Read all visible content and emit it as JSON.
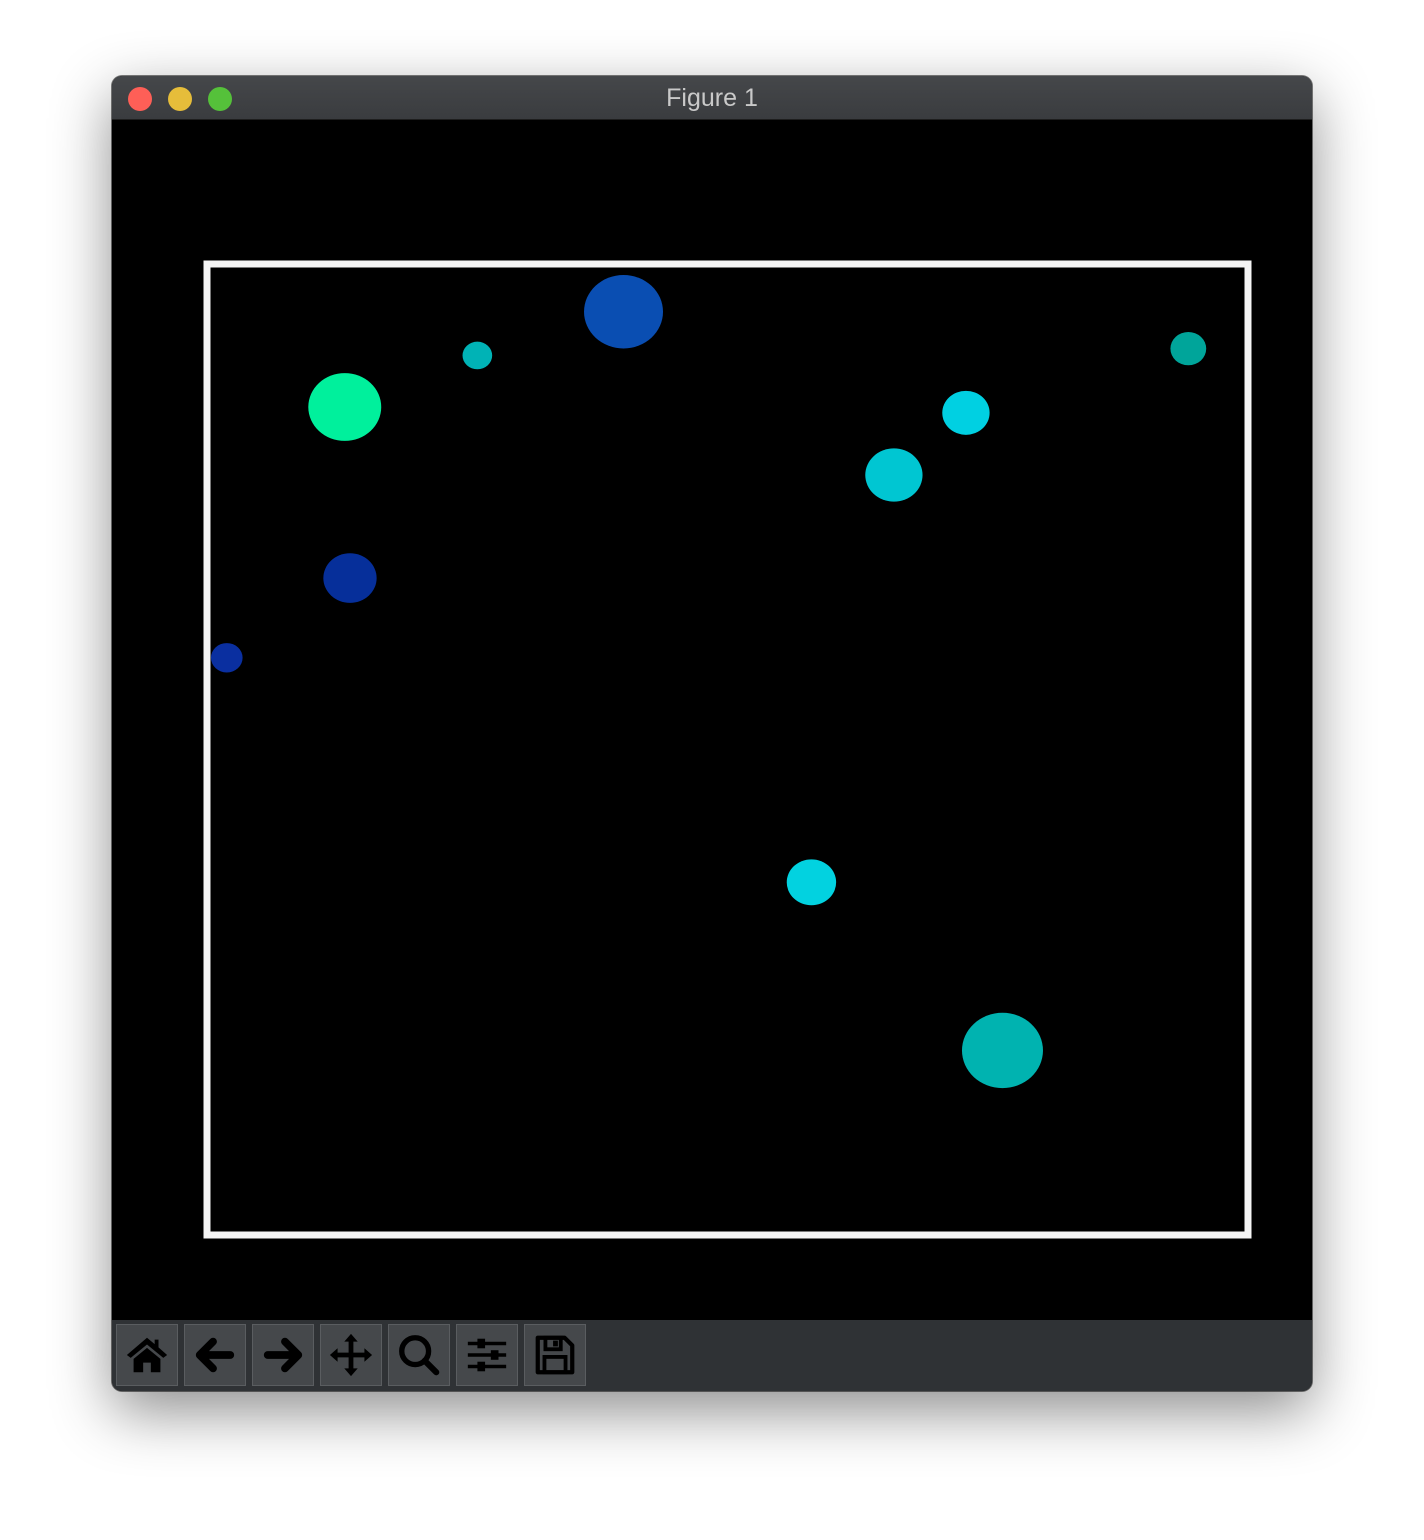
{
  "window": {
    "title": "Figure 1"
  },
  "toolbar": {
    "buttons": [
      "home",
      "back",
      "forward",
      "pan",
      "zoom",
      "configure-subplots",
      "save"
    ]
  },
  "colors": {
    "background": "#000000",
    "frame": "#f5f5f5"
  },
  "chart_data": {
    "type": "scatter",
    "title": "",
    "xlabel": "",
    "ylabel": "",
    "xlim": [
      0,
      1
    ],
    "ylim": [
      0,
      1
    ],
    "grid": false,
    "ticks": false,
    "points": [
      {
        "x": 0.398,
        "y": 0.955,
        "size": 1560,
        "color": "#0a4eb2"
      },
      {
        "x": 0.258,
        "y": 0.91,
        "size": 220,
        "color": "#00b3b6"
      },
      {
        "x": 0.131,
        "y": 0.857,
        "size": 1330,
        "color": "#00f09c"
      },
      {
        "x": 0.939,
        "y": 0.917,
        "size": 320,
        "color": "#00a59a"
      },
      {
        "x": 0.726,
        "y": 0.851,
        "size": 560,
        "color": "#00d0e2"
      },
      {
        "x": 0.657,
        "y": 0.787,
        "size": 820,
        "color": "#00c6d2"
      },
      {
        "x": 0.136,
        "y": 0.681,
        "size": 710,
        "color": "#062f9a"
      },
      {
        "x": 0.018,
        "y": 0.599,
        "size": 250,
        "color": "#0a2fa0"
      },
      {
        "x": 0.578,
        "y": 0.368,
        "size": 610,
        "color": "#02d2e0"
      },
      {
        "x": 0.761,
        "y": 0.195,
        "size": 1640,
        "color": "#00b3b0"
      }
    ]
  }
}
